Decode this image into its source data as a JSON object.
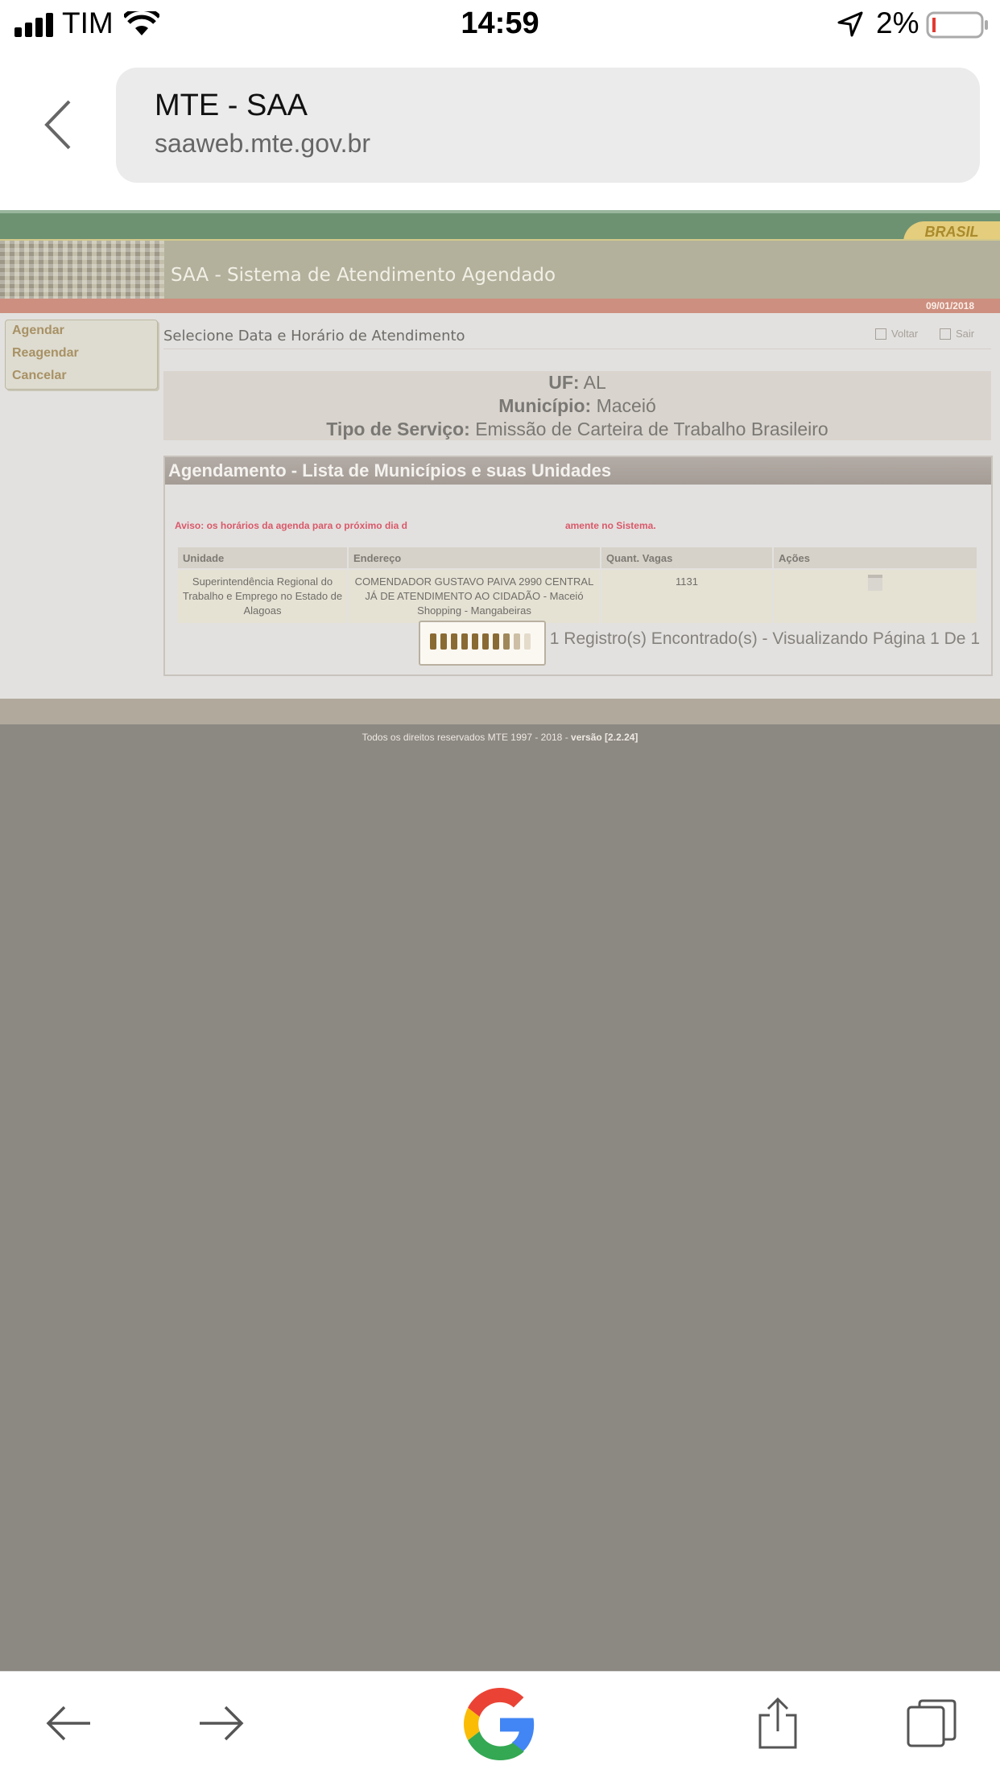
{
  "status_bar": {
    "carrier": "TIM",
    "time": "14:59",
    "battery": "2%"
  },
  "browser": {
    "page_title": "MTE - SAA",
    "domain": "saaweb.mte.gov.br"
  },
  "site": {
    "brand": "BRASIL",
    "system_title": "SAA - Sistema de Atendimento Agendado",
    "date": "09/01/2018",
    "nav": [
      "Agendar",
      "Reagendar",
      "Cancelar"
    ],
    "heading": "Selecione Data e Horário de Atendimento",
    "actions": {
      "back": "Voltar",
      "exit": "Sair"
    },
    "info": {
      "uf_label": "UF:",
      "uf_value": "AL",
      "mun_label": "Município:",
      "mun_value": "Maceió",
      "svc_label": "Tipo de Serviço:",
      "svc_value": "Emissão de Carteira de Trabalho Brasileiro"
    },
    "panel_title": "Agendamento - Lista de Municípios e suas Unidades",
    "notice_left": "Aviso: os horários da agenda para o próximo dia d",
    "notice_right": "amente no Sistema.",
    "table": {
      "headers": [
        "Unidade",
        "Endereço",
        "Quant. Vagas",
        "Ações"
      ],
      "rows": [
        {
          "unidade": "Superintendência Regional do Trabalho e Emprego no Estado de Alagoas",
          "endereco": "COMENDADOR GUSTAVO PAIVA 2990 CENTRAL JÁ DE ATENDIMENTO AO CIDADÃO - Maceió Shopping - Mangabeiras",
          "vagas": "1131"
        }
      ]
    },
    "records": "1 Registro(s) Encontrado(s) - Visualizando Página 1 De 1",
    "footer_text": "Todos os direitos reservados MTE 1997 - 2018 - ",
    "footer_version": "versão [2.2.24]"
  },
  "colors": {
    "accent_green": "#6d9272",
    "header_tan": "#b3b19c",
    "date_bar": "#cd8f7f",
    "notice_red": "#d9596a"
  },
  "icons": [
    "signal-icon",
    "wifi-icon",
    "location-icon",
    "battery-icon",
    "back-chevron-icon",
    "google-icon",
    "share-icon",
    "tabs-icon"
  ]
}
